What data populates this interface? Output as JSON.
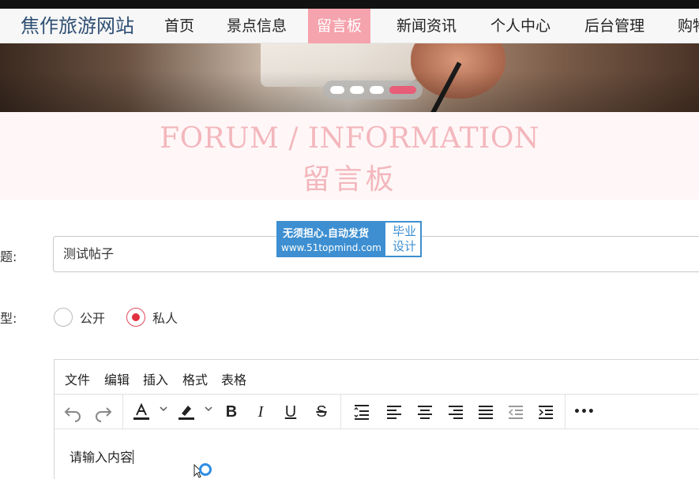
{
  "nav": {
    "site_title": "焦作旅游网站",
    "items": [
      "首页",
      "景点信息",
      "留言板",
      "新闻资讯",
      "个人中心",
      "后台管理",
      "购物"
    ],
    "active_index": 2
  },
  "banner": {
    "slides": 4,
    "active_slide": 4
  },
  "section": {
    "title_en": "FORUM / INFORMATION",
    "title_zh": "留言板"
  },
  "form": {
    "title_label": "题:",
    "title_value": "测试帖子",
    "type_label": "型:",
    "type_options": [
      "公开",
      "私人"
    ],
    "type_selected": "私人"
  },
  "stamp": {
    "line1": "无须担心.自动发货",
    "line2": "www.51topmind.com",
    "right_top": "毕业",
    "right_bottom": "设计"
  },
  "editor": {
    "menu": [
      "文件",
      "编辑",
      "插入",
      "格式",
      "表格"
    ],
    "toolbar_icons": [
      "undo-icon",
      "redo-icon",
      "text-color-icon",
      "highlight-icon",
      "bold-icon",
      "italic-icon",
      "underline-icon",
      "strikethrough-icon",
      "line-height-icon",
      "align-left-icon",
      "align-center-icon",
      "align-right-icon",
      "align-justify-icon",
      "outdent-icon",
      "indent-icon",
      "more-icon"
    ],
    "toolbar_glyphs": {
      "bold": "B",
      "italic": "I",
      "underline": "U",
      "strike": "S",
      "more": "•••"
    },
    "placeholder": "请输入内容"
  },
  "colors": {
    "accent": "#f5a3ad",
    "nav_title": "#2f4f73",
    "heading": "#f3b7bd",
    "radio": "#e1303f",
    "stamp": "#3d8fd1"
  }
}
